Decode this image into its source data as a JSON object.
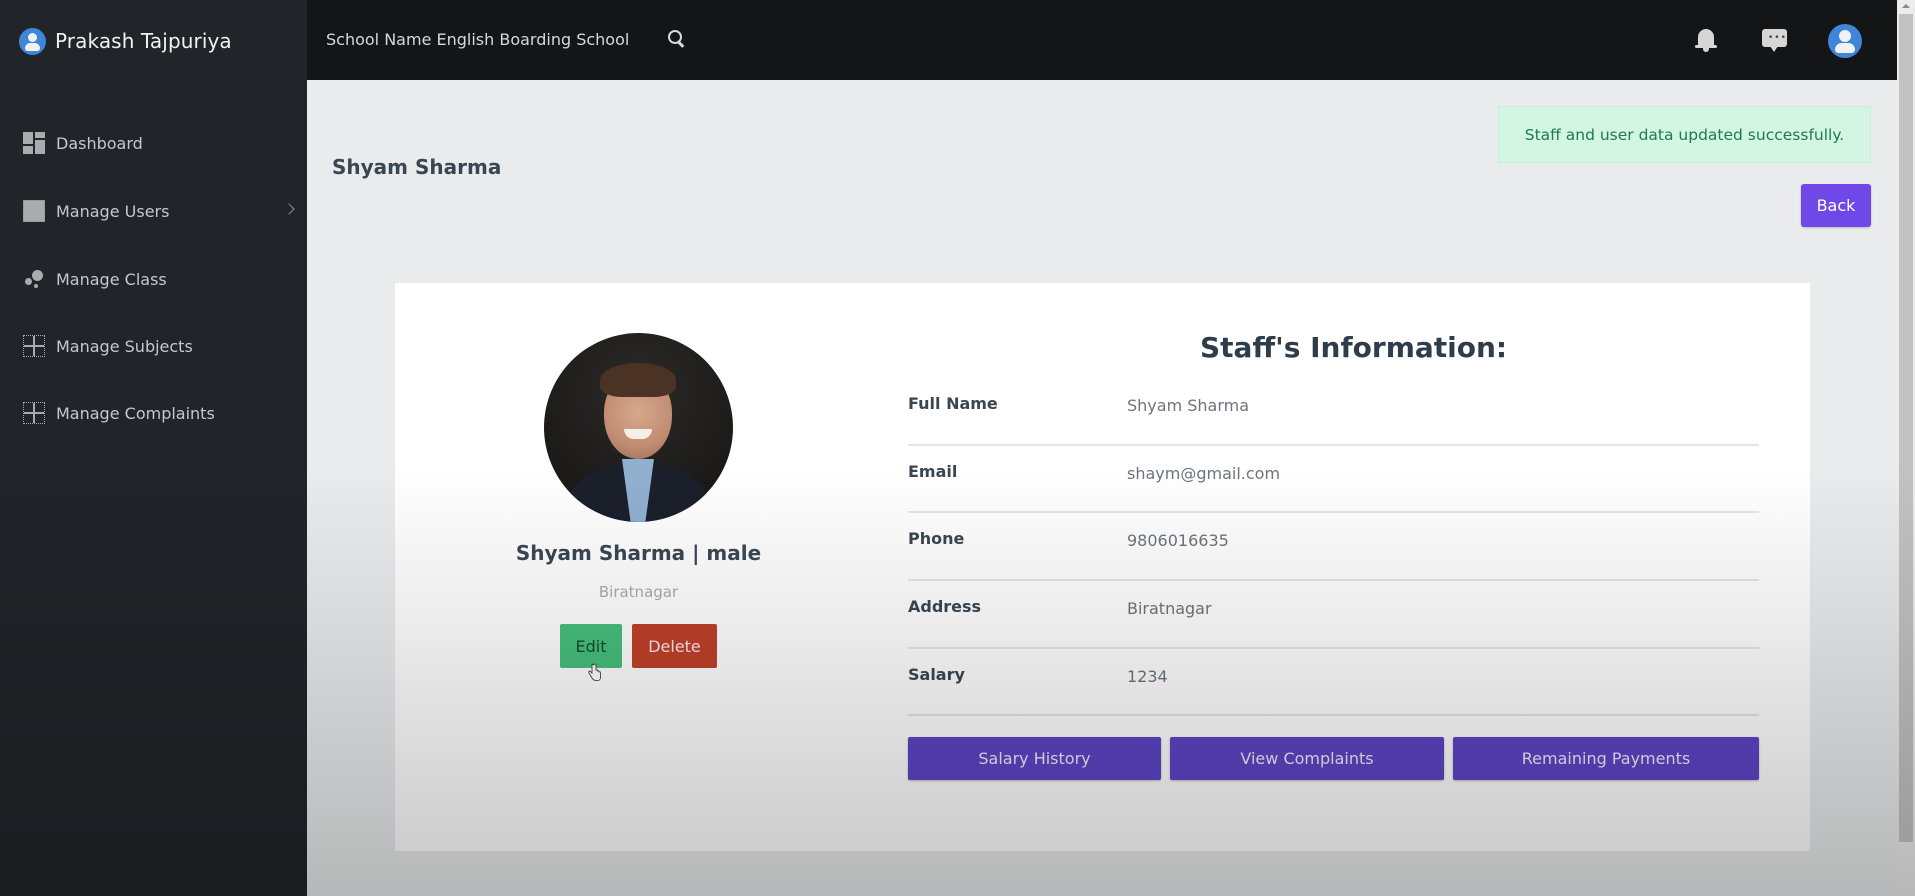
{
  "sidebar": {
    "user_name": "Prakash Tajpuriya",
    "items": [
      {
        "label": "Dashboard",
        "icon": "dashboard-icon"
      },
      {
        "label": "Manage Users",
        "icon": "users-icon",
        "has_submenu": true
      },
      {
        "label": "Manage Class",
        "icon": "class-icon"
      },
      {
        "label": "Manage Subjects",
        "icon": "subjects-icon"
      },
      {
        "label": "Manage Complaints",
        "icon": "complaints-icon"
      }
    ]
  },
  "topbar": {
    "school_name": "School Name English Boarding School",
    "icons": [
      "search-icon",
      "bell-icon",
      "chat-icon",
      "user-avatar-icon"
    ]
  },
  "page": {
    "title": "Shyam Sharma",
    "alert": "Staff and user data updated successfully.",
    "back_label": "Back"
  },
  "profile": {
    "name_gender": "Shyam Sharma | male",
    "city": "Biratnagar",
    "edit_label": "Edit",
    "delete_label": "Delete"
  },
  "info": {
    "title": "Staff's Information:",
    "rows": [
      {
        "label": "Full Name",
        "value": "Shyam Sharma"
      },
      {
        "label": "Email",
        "value": "shaym@gmail.com"
      },
      {
        "label": "Phone",
        "value": "9806016635"
      },
      {
        "label": "Address",
        "value": "Biratnagar"
      },
      {
        "label": "Salary",
        "value": "1234"
      }
    ],
    "actions": {
      "salary_history": "Salary History",
      "view_complaints": "View Complaints",
      "remaining_payments": "Remaining Payments"
    }
  },
  "colors": {
    "primary_purple": "#5d45c6",
    "back_purple": "#7048e8",
    "edit_green": "#47c07c",
    "delete_red": "#c0412a",
    "alert_bg": "#d3f5e4",
    "sidebar_bg": "#212529",
    "topbar_bg": "#141517"
  }
}
